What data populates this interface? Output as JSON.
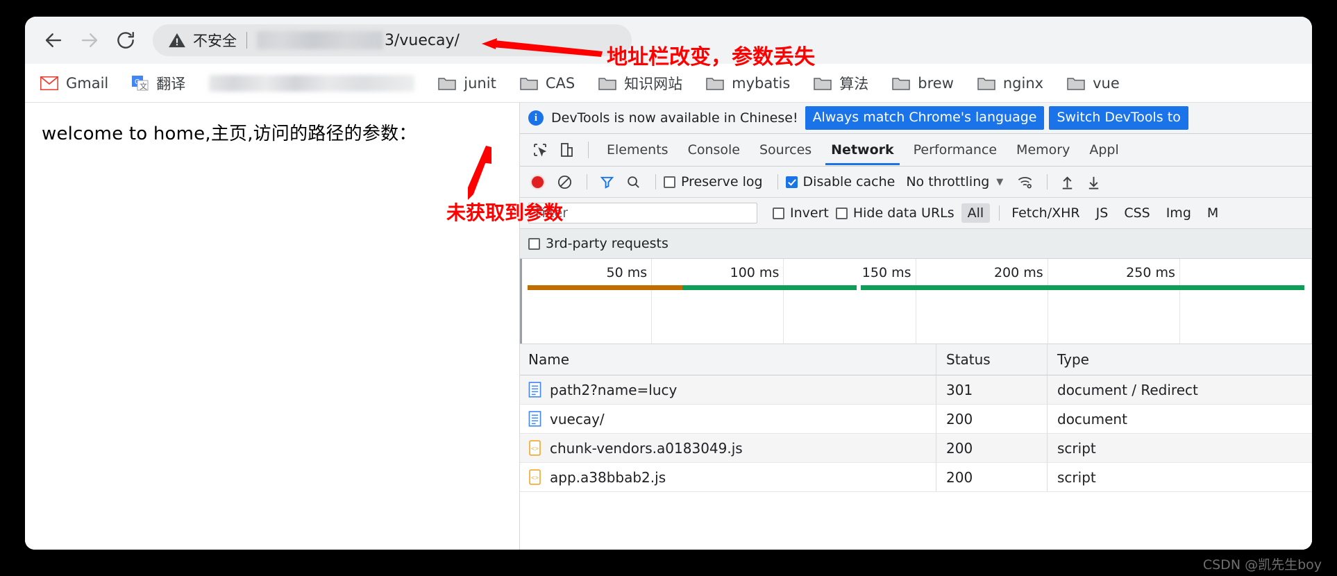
{
  "browser": {
    "nav": {
      "back_label": "Back",
      "forward_label": "Forward",
      "reload_label": "Reload"
    },
    "omnibox": {
      "security_label": "不安全",
      "security_icon": "warning-triangle-icon",
      "url_visible_tail": "3/vuecay/",
      "url_redacted": true
    },
    "bookmarks": [
      {
        "label": "Gmail",
        "icon": "gmail-icon"
      },
      {
        "label": "翻译",
        "icon": "google-translate-icon"
      },
      {
        "label": "",
        "icon": "blurred-bookmarks",
        "redacted": true
      },
      {
        "label": "junit",
        "icon": "folder-icon"
      },
      {
        "label": "CAS",
        "icon": "folder-icon"
      },
      {
        "label": "知识网站",
        "icon": "folder-icon"
      },
      {
        "label": "mybatis",
        "icon": "folder-icon"
      },
      {
        "label": "算法",
        "icon": "folder-icon"
      },
      {
        "label": "brew",
        "icon": "folder-icon"
      },
      {
        "label": "nginx",
        "icon": "folder-icon"
      },
      {
        "label": "vue",
        "icon": "folder-icon"
      }
    ]
  },
  "page": {
    "body_text": "welcome to home,主页,访问的路径的参数："
  },
  "devtools": {
    "banner": {
      "icon": "info-icon",
      "text": "DevTools is now available in Chinese!",
      "buttons": [
        "Always match Chrome's language",
        "Switch DevTools to"
      ]
    },
    "left_icons": [
      {
        "name": "inspect-element-icon"
      },
      {
        "name": "device-toolbar-icon"
      }
    ],
    "tabs": [
      {
        "label": "Elements",
        "active": false
      },
      {
        "label": "Console",
        "active": false
      },
      {
        "label": "Sources",
        "active": false
      },
      {
        "label": "Network",
        "active": true
      },
      {
        "label": "Performance",
        "active": false
      },
      {
        "label": "Memory",
        "active": false
      },
      {
        "label": "Appl",
        "active": false
      }
    ],
    "toolbar": {
      "record_icon": "record-dot-icon",
      "clear_icon": "clear-no-entry-icon",
      "filter_icon": "funnel-filter-icon",
      "search_icon": "search-icon",
      "preserve_log_label": "Preserve log",
      "preserve_log_checked": false,
      "disable_cache_label": "Disable cache",
      "disable_cache_checked": true,
      "throttling_value": "No throttling",
      "throttling_caret": "▼",
      "wifi_icon": "network-conditions-icon",
      "import_icon": "import-har-icon",
      "export_icon": "export-har-icon"
    },
    "filterbar": {
      "filter_placeholder": "Filter",
      "filter_value": "",
      "invert_label": "Invert",
      "invert_checked": false,
      "hide_data_urls_label": "Hide data URLs",
      "hide_data_urls_checked": false,
      "types": [
        {
          "label": "All",
          "selected": true
        },
        {
          "label": "Fetch/XHR",
          "selected": false
        },
        {
          "label": "JS",
          "selected": false
        },
        {
          "label": "CSS",
          "selected": false
        },
        {
          "label": "Img",
          "selected": false
        },
        {
          "label": "M",
          "selected": false
        }
      ]
    },
    "thirdparty": {
      "label": "3rd-party requests",
      "checked": false
    },
    "overview": {
      "ticks": [
        "50 ms",
        "100 ms",
        "150 ms",
        "200 ms",
        "250 ms"
      ],
      "bars": [
        {
          "color": "#bf6c00",
          "left_pct": 1.0,
          "width_pct": 19.5
        },
        {
          "color": "#0f9d58",
          "left_pct": 20.5,
          "width_pct": 22.0
        },
        {
          "color": "#0f9d58",
          "left_pct": 43.0,
          "width_pct": 56.0
        }
      ]
    },
    "table": {
      "columns": [
        "Name",
        "Status",
        "Type"
      ],
      "rows": [
        {
          "name": "path2?name=lucy",
          "status": "301",
          "type": "document / Redirect",
          "icon": "document-icon"
        },
        {
          "name": "vuecay/",
          "status": "200",
          "type": "document",
          "icon": "document-icon"
        },
        {
          "name": "chunk-vendors.a0183049.js",
          "status": "200",
          "type": "script",
          "icon": "script-icon"
        },
        {
          "name": "app.a38bbab2.js",
          "status": "200",
          "type": "script",
          "icon": "script-icon"
        }
      ]
    }
  },
  "annotations": {
    "url_note": "地址栏改变，参数丢失",
    "param_note": "未获取到参数",
    "color": "#ff0000"
  },
  "watermark": "CSDN @凯先生boy"
}
